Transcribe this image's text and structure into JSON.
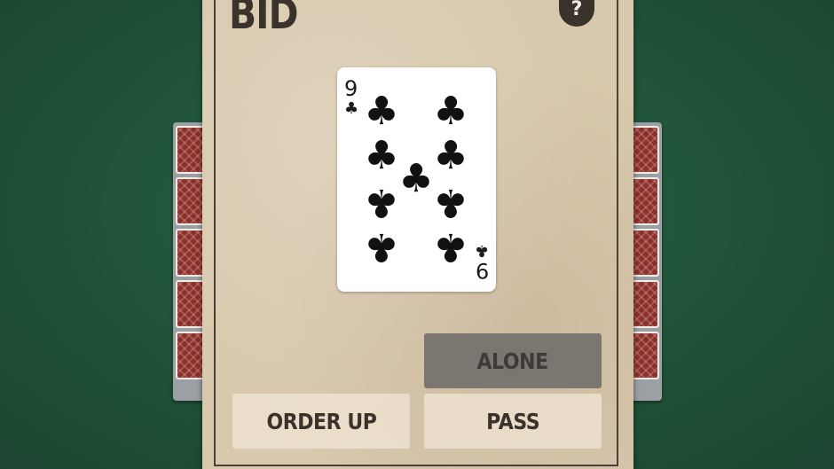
{
  "screen": {
    "title": "BID",
    "help_label": "?"
  },
  "card": {
    "rank": "9",
    "suit_symbol": "♣",
    "suit": "clubs"
  },
  "buttons": {
    "alone": "ALONE",
    "order_up": "ORDER UP",
    "pass": "PASS"
  },
  "table": {
    "left_stack_count": 5,
    "right_stack_count": 5
  },
  "colors": {
    "table_felt": "#22563a",
    "panel": "#d8c8ad",
    "card_back": "#8c2f2a",
    "text_dark": "#3a332c"
  }
}
